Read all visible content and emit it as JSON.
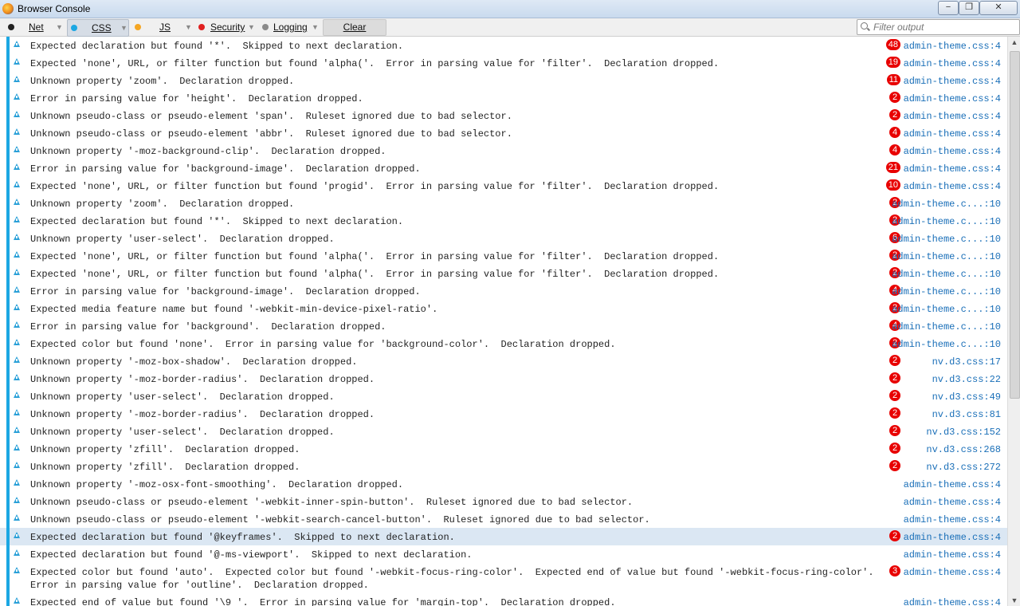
{
  "window": {
    "title": "Browser Console"
  },
  "toolbar": {
    "net": "Net",
    "css": "CSS",
    "js": "JS",
    "security": "Security",
    "logging": "Logging",
    "clear": "Clear",
    "filter_placeholder": "Filter output",
    "colors": {
      "css": "#1ba7e3",
      "js": "#f5a623",
      "security": "#e02020",
      "logging": "#8a8a8a",
      "net": "#222222"
    }
  },
  "log": {
    "entries": [
      {
        "message": "Expected declaration but found '*'.  Skipped to next declaration.",
        "count": "48",
        "source": "admin-theme.css:4"
      },
      {
        "message": "Expected 'none', URL, or filter function but found 'alpha('.  Error in parsing value for 'filter'.  Declaration dropped.",
        "count": "19",
        "source": "admin-theme.css:4"
      },
      {
        "message": "Unknown property 'zoom'.  Declaration dropped.",
        "count": "11",
        "source": "admin-theme.css:4"
      },
      {
        "message": "Error in parsing value for 'height'.  Declaration dropped.",
        "count": "2",
        "source": "admin-theme.css:4"
      },
      {
        "message": "Unknown pseudo-class or pseudo-element 'span'.  Ruleset ignored due to bad selector.",
        "count": "2",
        "source": "admin-theme.css:4"
      },
      {
        "message": "Unknown pseudo-class or pseudo-element 'abbr'.  Ruleset ignored due to bad selector.",
        "count": "4",
        "source": "admin-theme.css:4"
      },
      {
        "message": "Unknown property '-moz-background-clip'.  Declaration dropped.",
        "count": "4",
        "source": "admin-theme.css:4"
      },
      {
        "message": "Error in parsing value for 'background-image'.  Declaration dropped.",
        "count": "21",
        "source": "admin-theme.css:4"
      },
      {
        "message": "Expected 'none', URL, or filter function but found 'progid'.  Error in parsing value for 'filter'.  Declaration dropped.",
        "count": "10",
        "source": "admin-theme.css:4"
      },
      {
        "message": "Unknown property 'zoom'.  Declaration dropped.",
        "count": "2",
        "source": "admin-theme.c...:10"
      },
      {
        "message": "Expected declaration but found '*'.  Skipped to next declaration.",
        "count": "2",
        "source": "admin-theme.c...:10"
      },
      {
        "message": "Unknown property 'user-select'.  Declaration dropped.",
        "count": "6",
        "source": "admin-theme.c...:10"
      },
      {
        "message": "Expected 'none', URL, or filter function but found 'alpha('.  Error in parsing value for 'filter'.  Declaration dropped.",
        "count": "2",
        "source": "admin-theme.c...:10"
      },
      {
        "message": "Expected 'none', URL, or filter function but found 'alpha('.  Error in parsing value for 'filter'.  Declaration dropped.",
        "count": "2",
        "source": "admin-theme.c...:10"
      },
      {
        "message": "Error in parsing value for 'background-image'.  Declaration dropped.",
        "count": "4",
        "source": "admin-theme.c...:10"
      },
      {
        "message": "Expected media feature name but found '-webkit-min-device-pixel-ratio'.",
        "count": "2",
        "source": "admin-theme.c...:10"
      },
      {
        "message": "Error in parsing value for 'background'.  Declaration dropped.",
        "count": "4",
        "source": "admin-theme.c...:10"
      },
      {
        "message": "Expected color but found 'none'.  Error in parsing value for 'background-color'.  Declaration dropped.",
        "count": "2",
        "source": "admin-theme.c...:10"
      },
      {
        "message": "Unknown property '-moz-box-shadow'.  Declaration dropped.",
        "count": "2",
        "source": "nv.d3.css:17"
      },
      {
        "message": "Unknown property '-moz-border-radius'.  Declaration dropped.",
        "count": "2",
        "source": "nv.d3.css:22"
      },
      {
        "message": "Unknown property 'user-select'.  Declaration dropped.",
        "count": "2",
        "source": "nv.d3.css:49"
      },
      {
        "message": "Unknown property '-moz-border-radius'.  Declaration dropped.",
        "count": "2",
        "source": "nv.d3.css:81"
      },
      {
        "message": "Unknown property 'user-select'.  Declaration dropped.",
        "count": "2",
        "source": "nv.d3.css:152"
      },
      {
        "message": "Unknown property 'zfill'.  Declaration dropped.",
        "count": "2",
        "source": "nv.d3.css:268"
      },
      {
        "message": "Unknown property 'zfill'.  Declaration dropped.",
        "count": "2",
        "source": "nv.d3.css:272"
      },
      {
        "message": "Unknown property '-moz-osx-font-smoothing'.  Declaration dropped.",
        "count": "",
        "source": "admin-theme.css:4"
      },
      {
        "message": "Unknown pseudo-class or pseudo-element '-webkit-inner-spin-button'.  Ruleset ignored due to bad selector.",
        "count": "",
        "source": "admin-theme.css:4"
      },
      {
        "message": "Unknown pseudo-class or pseudo-element '-webkit-search-cancel-button'.  Ruleset ignored due to bad selector.",
        "count": "",
        "source": "admin-theme.css:4"
      },
      {
        "message": "Expected declaration but found '@keyframes'.  Skipped to next declaration.",
        "count": "2",
        "source": "admin-theme.css:4",
        "selected": true
      },
      {
        "message": "Expected declaration but found '@-ms-viewport'.  Skipped to next declaration.",
        "count": "",
        "source": "admin-theme.css:4"
      },
      {
        "message": "Expected color but found 'auto'.  Expected color but found '-webkit-focus-ring-color'.  Expected end of value but found '-webkit-focus-ring-color'.\nError in parsing value for 'outline'.  Declaration dropped.",
        "count": "3",
        "source": "admin-theme.css:4"
      },
      {
        "message": "Expected end of value but found '\\9 '.  Error in parsing value for 'margin-top'.  Declaration dropped.",
        "count": "",
        "source": "admin-theme.css:4"
      }
    ]
  }
}
